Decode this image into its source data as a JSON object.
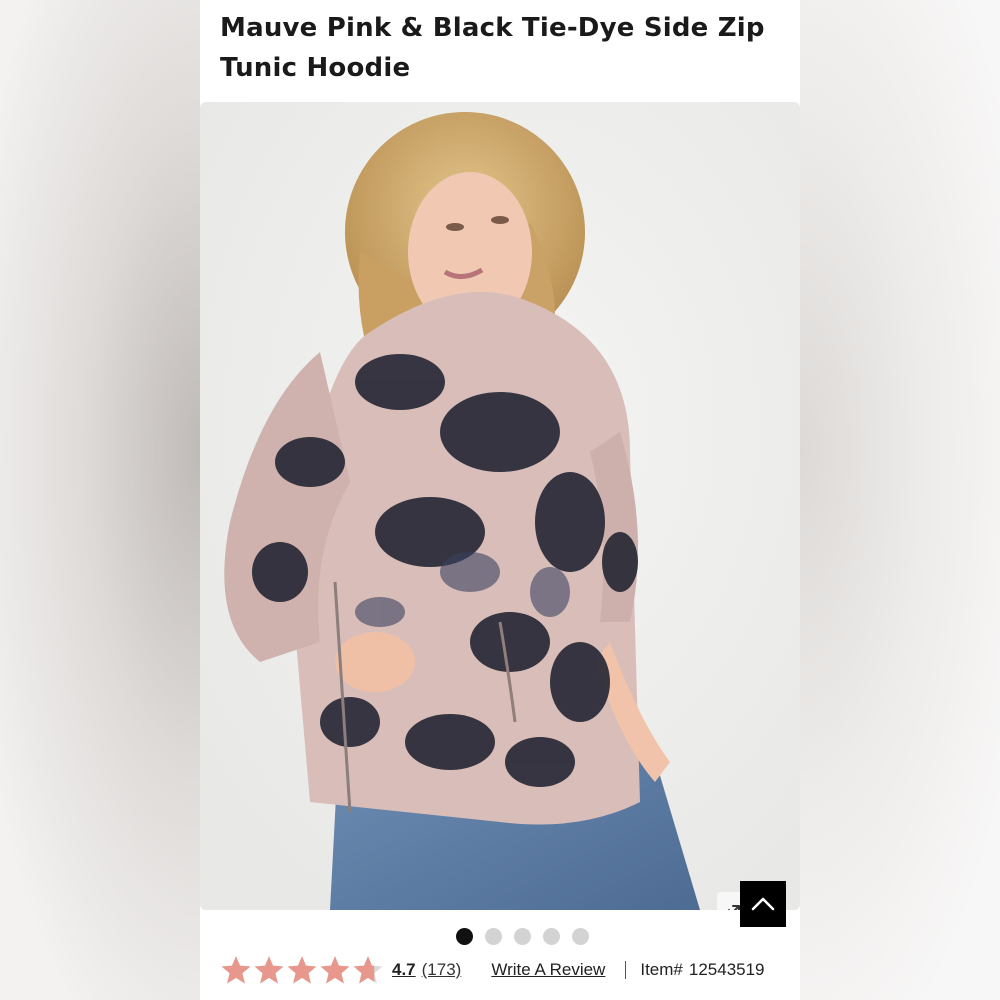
{
  "product": {
    "title": "Mauve Pink & Black Tie-Dye Side Zip Tunic Hoodie",
    "image_alt": "Model wearing mauve pink and black tie-dye side zip tunic hoodie with jeans"
  },
  "gallery": {
    "slide_count": 5,
    "active_slide": 1,
    "zoom_icon": "pinch-zoom-hand-icon",
    "back_to_top_icon": "chevron-up-icon"
  },
  "rating": {
    "value": "4.7",
    "count": "(173)",
    "stars": 4.7,
    "star_color": "#e8978c",
    "write_review_label": "Write A Review"
  },
  "item": {
    "label": "Item#",
    "number": "12543519"
  }
}
